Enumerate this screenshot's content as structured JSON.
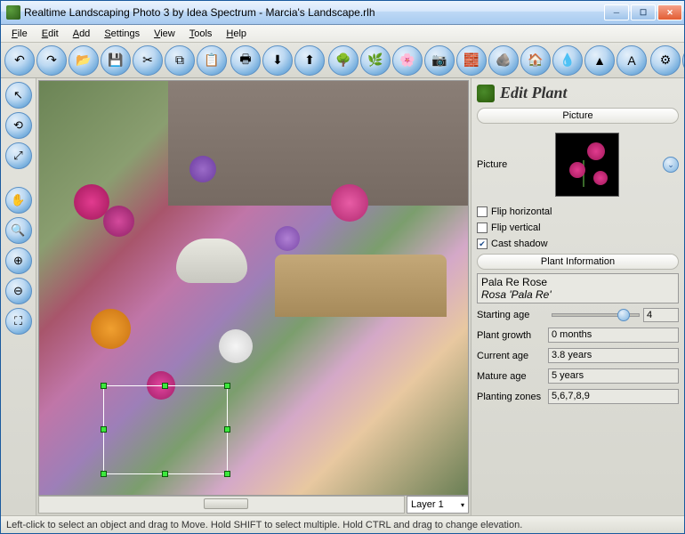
{
  "window": {
    "title": "Realtime Landscaping Photo 3 by Idea Spectrum - Marcia's Landscape.rlh"
  },
  "menu": {
    "file": "File",
    "edit": "Edit",
    "add": "Add",
    "settings": "Settings",
    "view": "View",
    "tools": "Tools",
    "help": "Help"
  },
  "layer": "Layer 1",
  "panel": {
    "title": "Edit Plant",
    "section_picture": "Picture",
    "picture_label": "Picture",
    "flip_horizontal": "Flip horizontal",
    "flip_vertical": "Flip vertical",
    "cast_shadow": "Cast shadow",
    "cast_shadow_checked": true,
    "section_info": "Plant Information",
    "plant_name": "Pala Re Rose",
    "plant_sci": "Rosa 'Pala Re'",
    "starting_age_label": "Starting age",
    "starting_age_value": "4",
    "plant_growth_label": "Plant growth",
    "plant_growth_value": "0 months",
    "current_age_label": "Current age",
    "current_age_value": "3.8 years",
    "mature_age_label": "Mature age",
    "mature_age_value": "5 years",
    "planting_zones_label": "Planting zones",
    "planting_zones_value": "5,6,7,8,9"
  },
  "statusbar": "Left-click to select an object and drag to Move. Hold SHIFT to select multiple. Hold CTRL and drag to change elevation."
}
